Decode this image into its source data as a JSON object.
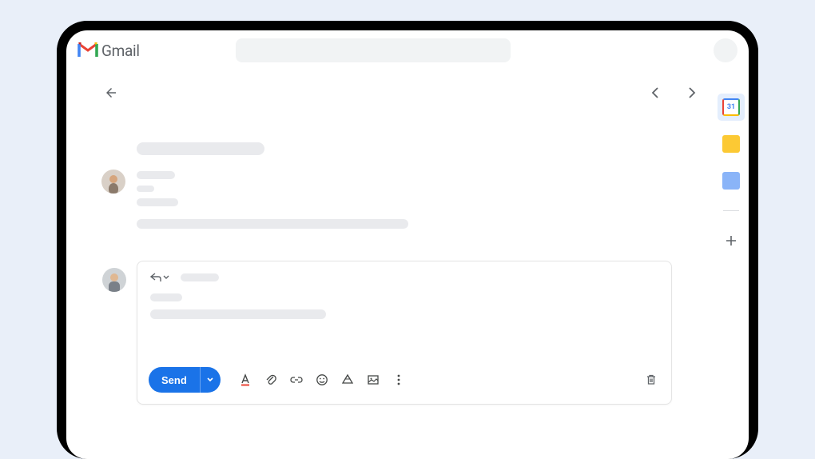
{
  "header": {
    "app_name": "Gmail"
  },
  "sidepanel": {
    "calendar_date": "31"
  },
  "compose": {
    "send_label": "Send"
  }
}
